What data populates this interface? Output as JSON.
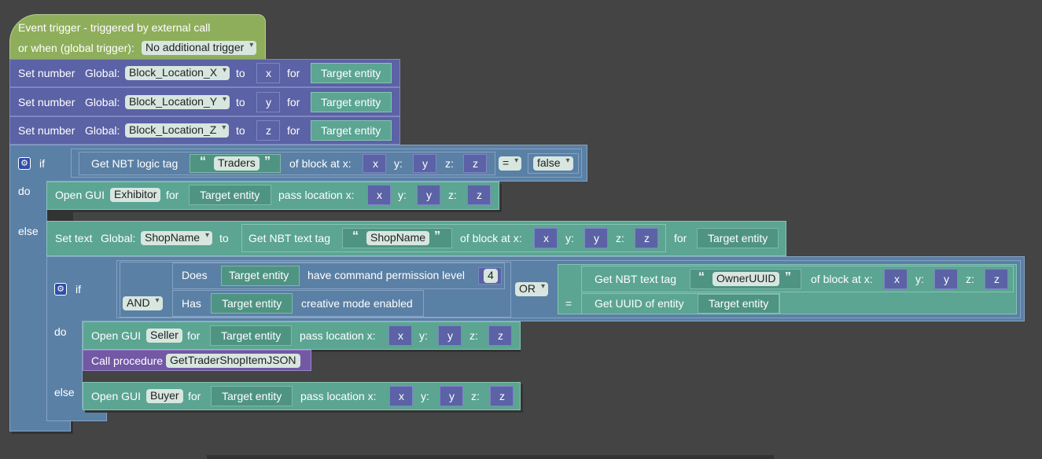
{
  "event": {
    "title": "Event trigger - triggered by external call",
    "global_label": "or when (global trigger):",
    "global_value": "No additional trigger"
  },
  "set_numbers": [
    {
      "label": "Set number",
      "scope": "Global:",
      "var": "Block_Location_X",
      "to": "to",
      "value": "x",
      "for": "for",
      "target": "Target entity"
    },
    {
      "label": "Set number",
      "scope": "Global:",
      "var": "Block_Location_Y",
      "to": "to",
      "value": "y",
      "for": "for",
      "target": "Target entity"
    },
    {
      "label": "Set number",
      "scope": "Global:",
      "var": "Block_Location_Z",
      "to": "to",
      "value": "z",
      "for": "for",
      "target": "Target entity"
    }
  ],
  "if1": {
    "if": "if",
    "do": "do",
    "else": "else",
    "get_nbt_logic": "Get NBT logic tag",
    "tag": "Traders",
    "of_block": "of block at x:",
    "x": "x",
    "y_label": "y:",
    "y": "y",
    "z_label": "z:",
    "z": "z",
    "op": "=",
    "bool": "false"
  },
  "open_exhibitor": {
    "label": "Open GUI",
    "gui": "Exhibitor",
    "for": "for",
    "target": "Target entity",
    "pass": "pass location x:",
    "x": "x",
    "y_label": "y:",
    "y": "y",
    "z_label": "z:",
    "z": "z"
  },
  "set_text": {
    "label": "Set text",
    "scope": "Global:",
    "var": "ShopName",
    "to": "to",
    "get_nbt_text": "Get NBT text tag",
    "tag": "ShopName",
    "of_block": "of block at x:",
    "x": "x",
    "y_label": "y:",
    "y": "y",
    "z_label": "z:",
    "z": "z",
    "for": "for",
    "target": "Target entity"
  },
  "if2": {
    "if": "if",
    "do": "do",
    "else": "else",
    "and": "AND",
    "or": "OR",
    "eq": "=",
    "does": "Does",
    "target1": "Target entity",
    "perm": "have command permission level",
    "level": "4",
    "has": "Has",
    "target2": "Target entity",
    "creative": "creative mode enabled",
    "get_nbt_text": "Get NBT text tag",
    "tag": "OwnerUUID",
    "of_block": "of block at x:",
    "x": "x",
    "y_label": "y:",
    "y": "y",
    "z_label": "z:",
    "z": "z",
    "get_uuid": "Get UUID of entity",
    "target3": "Target entity"
  },
  "open_seller": {
    "label": "Open GUI",
    "gui": "Seller",
    "for": "for",
    "target": "Target entity",
    "pass": "pass location x:",
    "x": "x",
    "y_label": "y:",
    "y": "y",
    "z_label": "z:",
    "z": "z"
  },
  "call_proc": {
    "label": "Call procedure",
    "name": "GetTraderShopItemJSON"
  },
  "open_buyer": {
    "label": "Open GUI",
    "gui": "Buyer",
    "for": "for",
    "target": "Target entity",
    "pass": "pass location x:",
    "x": "x",
    "y_label": "y:",
    "y": "y",
    "z_label": "z:",
    "z": "z"
  },
  "colors": {
    "workspace": "#444444",
    "event": "#8fae5b",
    "variable": "#5b62a5",
    "logic": "#5b80a5",
    "gui": "#5ba592",
    "procedure": "#7258a5",
    "field": "#d7e6df"
  }
}
